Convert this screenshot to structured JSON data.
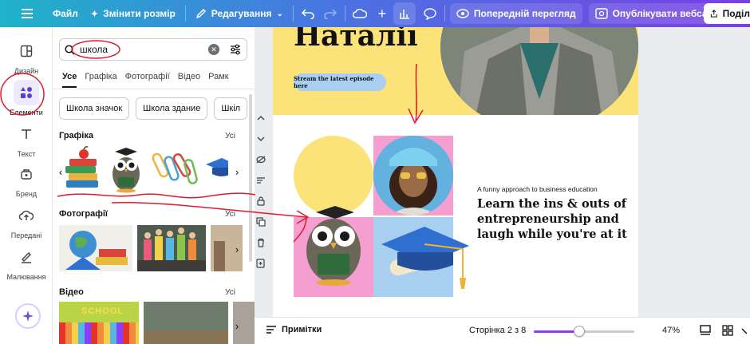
{
  "topbar": {
    "menu_icon": "hamburger-icon",
    "file": "Файл",
    "resize": "Змінити розмір",
    "editing": "Редагування",
    "preview": "Попередній перегляд",
    "publish": "Опублікувати вебсайт",
    "share": "Поділ"
  },
  "rail": {
    "items": [
      {
        "label": "Дизайн",
        "icon": "design-icon"
      },
      {
        "label": "Елементи",
        "icon": "elements-icon"
      },
      {
        "label": "Текст",
        "icon": "text-icon"
      },
      {
        "label": "Бренд",
        "icon": "brand-icon"
      },
      {
        "label": "Передані",
        "icon": "uploads-icon"
      },
      {
        "label": "Малювання",
        "icon": "draw-icon"
      }
    ]
  },
  "panel": {
    "search_value": "школа",
    "tabs": [
      "Усе",
      "Графіка",
      "Фотографії",
      "Відео",
      "Рамк"
    ],
    "chips": [
      "Школа значок",
      "Школа здание",
      "Шкіл"
    ],
    "sections": {
      "graphics": {
        "title": "Графіка",
        "all": "Усі"
      },
      "photos": {
        "title": "Фотографії",
        "all": "Усі"
      },
      "video": {
        "title": "Відео",
        "all": "Усі"
      }
    },
    "video_thumb_text": "SCHOOL"
  },
  "canvas": {
    "page1_title": "Наталії",
    "pill": "Stream the latest episode here",
    "tagline": "A funny approach to business education",
    "headline": "Learn the ins & outs of entrepreneurship and laugh while you're at it"
  },
  "bottombar": {
    "notes": "Примітки",
    "page": "Сторінка 2 з 8",
    "zoom": "47%",
    "zoom_fraction": 0.45
  },
  "colors": {
    "accent": "#8b3dff",
    "page_yellow": "#fbe37a",
    "annotation_red": "#e0192b"
  }
}
